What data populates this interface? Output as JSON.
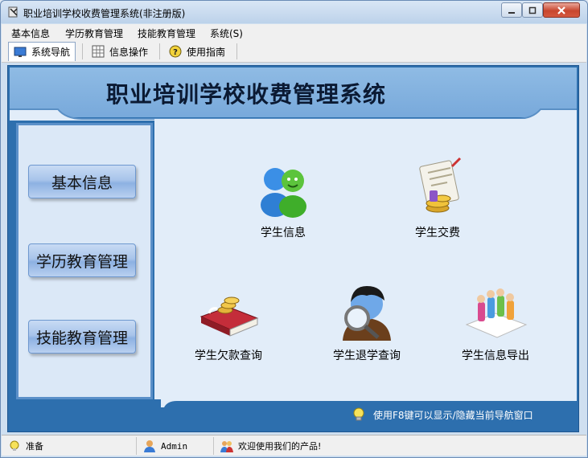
{
  "window": {
    "title": "职业培训学校收费管理系统(非注册版)"
  },
  "menu": [
    "基本信息",
    "学历教育管理",
    "技能教育管理",
    "系统(S)"
  ],
  "toolbar": {
    "tabs": [
      {
        "label": "系统导航",
        "icon": "monitor-icon",
        "active": true
      },
      {
        "label": "信息操作",
        "icon": "grid-icon",
        "active": false
      },
      {
        "label": "使用指南",
        "icon": "help-icon",
        "active": false
      }
    ]
  },
  "banner": {
    "title": "职业培训学校收费管理系统"
  },
  "nav": [
    "基本信息",
    "学历教育管理",
    "技能教育管理"
  ],
  "functions": [
    {
      "label": "学生信息",
      "icon": "students-icon"
    },
    {
      "label": "学生交费",
      "icon": "payment-icon"
    },
    {
      "label": "学生欠款查询",
      "icon": "debt-book-icon"
    },
    {
      "label": "学生退学查询",
      "icon": "search-person-icon"
    },
    {
      "label": "学生信息导出",
      "icon": "export-people-icon"
    }
  ],
  "hint": {
    "text": "使用F8键可以显示/隐藏当前导航窗口",
    "icon": "lightbulb-icon"
  },
  "status": {
    "ready": "准备",
    "user": "Admin",
    "welcome": "欢迎使用我们的产品!"
  },
  "colors": {
    "frame_blue": "#2d6fae",
    "banner_blue": "#8fbbe4",
    "panel_bg": "#e2edf9",
    "nav_button": "#a8c4ea"
  }
}
